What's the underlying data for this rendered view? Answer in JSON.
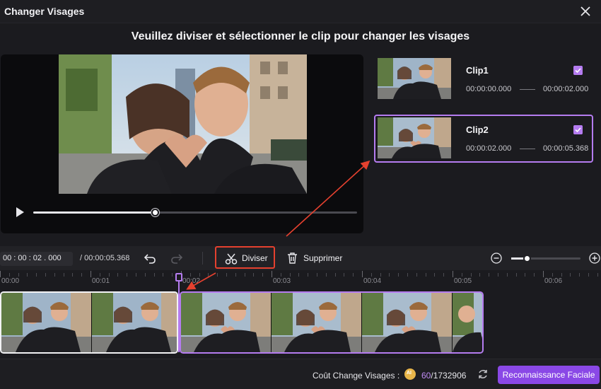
{
  "window": {
    "title": "Changer Visages"
  },
  "instruction": "Veuillez diviser et sélectionner le clip pour changer les visages",
  "player": {
    "progress": 0.375
  },
  "clips": [
    {
      "name": "Clip1",
      "start": "00:00:00.000",
      "end": "00:00:02.000",
      "checked": true,
      "selected": false
    },
    {
      "name": "Clip2",
      "start": "00:00:02.000",
      "end": "00:00:05.368",
      "checked": true,
      "selected": true
    }
  ],
  "toolbar": {
    "current_time": "00 : 00 : 02 . 000",
    "total_time": "/ 00:00:05.368",
    "split_label": "Diviser",
    "delete_label": "Supprimer",
    "zoom_level": 0.22
  },
  "ruler": {
    "labels": [
      "00:00",
      "00:01",
      "00:02",
      "00:03",
      "00:04",
      "00:05",
      "00:06"
    ]
  },
  "footer": {
    "cost_label": "Coût Change Visages :",
    "coin_symbol": "AI",
    "cost_used": "60",
    "cost_total": "/1732906",
    "action_label": "Reconnaissance Faciale"
  },
  "colors": {
    "accent": "#b57cf0",
    "highlight": "#e5412f",
    "primary_button": "#8a48e6"
  }
}
